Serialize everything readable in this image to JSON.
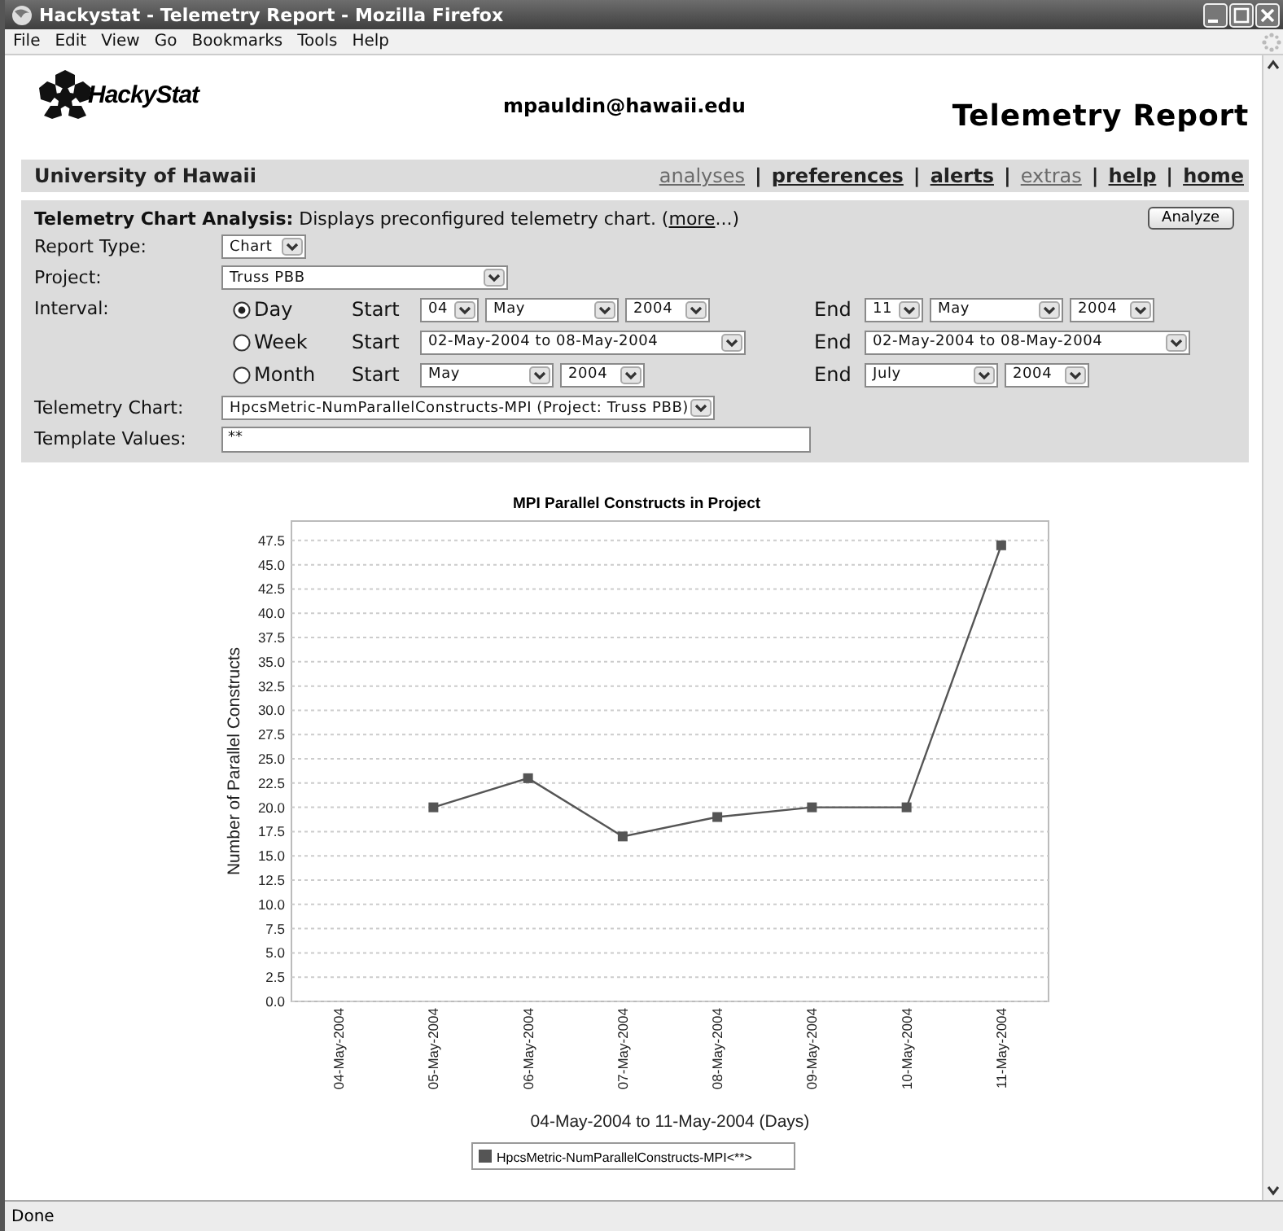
{
  "window": {
    "title": "Hackystat - Telemetry Report - Mozilla Firefox"
  },
  "menu": [
    "File",
    "Edit",
    "View",
    "Go",
    "Bookmarks",
    "Tools",
    "Help"
  ],
  "header": {
    "logo": "HackyStat",
    "user": "mpauldin@hawaii.edu",
    "title": "Telemetry Report"
  },
  "nav": {
    "org": "University of Hawaii",
    "links": [
      {
        "label": "analyses",
        "visited": true
      },
      {
        "label": "preferences",
        "visited": false
      },
      {
        "label": "alerts",
        "visited": false
      },
      {
        "label": "extras",
        "visited": true
      },
      {
        "label": "help",
        "visited": false
      },
      {
        "label": "home",
        "visited": false
      }
    ],
    "separators": [
      "|",
      "|",
      "|",
      "|",
      "|"
    ]
  },
  "form": {
    "description_before": "**Telemetry Chart Analysis:** Displays preconfigured telemetry chart. (",
    "more_link": "more",
    "description_after": "...)",
    "analyze_button": "Analyze",
    "report_type": {
      "label": "Report Type:",
      "value": "Chart"
    },
    "project": {
      "label": "Project:",
      "value": "Truss PBB"
    },
    "interval": {
      "label": "Interval:",
      "options": [
        {
          "label": "Day",
          "selected": true,
          "start_label": "Start",
          "start": [
            "04",
            "May",
            "2004"
          ],
          "end_label": "End",
          "end": [
            "11",
            "May",
            "2004"
          ]
        },
        {
          "label": "Week",
          "selected": false,
          "start_label": "Start",
          "start": [
            "02-May-2004 to 08-May-2004"
          ],
          "end_label": "End",
          "end": [
            "02-May-2004 to 08-May-2004"
          ]
        },
        {
          "label": "Month",
          "selected": false,
          "start_label": "Start",
          "start": [
            "May",
            "2004"
          ],
          "end_label": "End",
          "end": [
            "July",
            "2004"
          ]
        }
      ]
    },
    "telemetry_chart": {
      "label": "Telemetry Chart:",
      "value": "HpcsMetric-NumParallelConstructs-MPI (Project: Truss PBB)"
    },
    "template_values": {
      "label": "Template Values:",
      "value": "**"
    }
  },
  "chart": {
    "chart_data": {
      "type": "line",
      "title": "MPI Parallel Constructs in Project",
      "xlabel": "04-May-2004 to 11-May-2004 (Days)",
      "ylabel": "Number of Parallel Constructs",
      "categories": [
        "04-May-2004",
        "05-May-2004",
        "06-May-2004",
        "07-May-2004",
        "08-May-2004",
        "09-May-2004",
        "10-May-2004",
        "11-May-2004"
      ],
      "grid": true,
      "series": [
        {
          "name": "HpcsMetric-NumParallelConstructs-MPI<**>",
          "color": "#555555",
          "marker": "square",
          "values": [
            null,
            20,
            23,
            17,
            19,
            20,
            20,
            47
          ]
        }
      ],
      "ylim": [
        0,
        49.5
      ],
      "yticks": [
        {
          "value": 0,
          "label": "0.0"
        },
        {
          "value": 2.5,
          "label": "2.5"
        },
        {
          "value": 5,
          "label": "5.0"
        },
        {
          "value": 7.5,
          "label": "7.5"
        },
        {
          "value": 10,
          "label": "10.0"
        },
        {
          "value": 12.5,
          "label": "12.5"
        },
        {
          "value": 15,
          "label": "15.0"
        },
        {
          "value": 17.5,
          "label": "17.5"
        },
        {
          "value": 20,
          "label": "20.0"
        },
        {
          "value": 22.5,
          "label": "22.5"
        },
        {
          "value": 25,
          "label": "25.0"
        },
        {
          "value": 27.5,
          "label": "27.5"
        },
        {
          "value": 30,
          "label": "30.0"
        },
        {
          "value": 32.5,
          "label": "32.5"
        },
        {
          "value": 35,
          "label": "35.0"
        },
        {
          "value": 37.5,
          "label": "37.5"
        },
        {
          "value": 40,
          "label": "40.0"
        },
        {
          "value": 42.5,
          "label": "42.5"
        },
        {
          "value": 45,
          "label": "45.0"
        },
        {
          "value": 47.5,
          "label": "47.5"
        }
      ]
    }
  },
  "status_bar": {
    "text": "Done"
  }
}
